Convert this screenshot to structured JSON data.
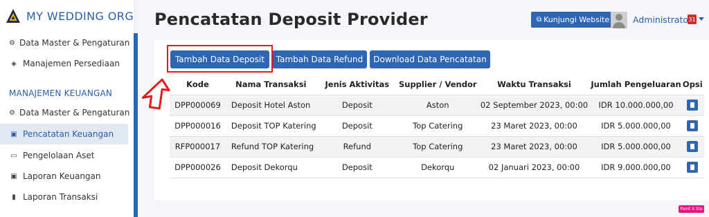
{
  "brand": {
    "title": "MY WEDDING ORGAN"
  },
  "sidebar": {
    "items_top": [
      {
        "label": "Data Master & Pengaturan",
        "icon": "gears-icon"
      },
      {
        "label": "Manajemen Persediaan",
        "icon": "cubes-icon"
      }
    ],
    "section_label": "MANAJEMEN KEUANGAN",
    "items_finance": [
      {
        "label": "Data Master & Pengaturan",
        "icon": "gears-icon"
      },
      {
        "label": "Pencatatan Keuangan",
        "icon": "money-icon",
        "active": true
      },
      {
        "label": "Pengelolaan Aset",
        "icon": "drive-icon"
      },
      {
        "label": "Laporan Keuangan",
        "icon": "money-icon"
      },
      {
        "label": "Laporan Transaksi",
        "icon": "book-icon"
      }
    ]
  },
  "header": {
    "page_title": "Pencatatan Deposit Provider",
    "visit_button": "Kunjungi Website",
    "user_name": "Administrator",
    "notification_count": "31"
  },
  "toolbar": {
    "add_deposit": "Tambah Data Deposit",
    "add_refund": "Tambah Data Refund",
    "download": "Download Data Pencatatan"
  },
  "table": {
    "columns": [
      "Kode",
      "Nama Transaksi",
      "Jenis Aktivitas",
      "Supplier / Vendor",
      "Waktu Transaksi",
      "Jumlah Pengeluaran",
      "Opsi"
    ],
    "rows": [
      [
        "DPP000069",
        "Deposit Hotel Aston",
        "Deposit",
        "Aston",
        "02 September 2023, 00:00",
        "IDR 10.000.000,00"
      ],
      [
        "DPP000016",
        "Deposit TOP Katering",
        "Deposit",
        "Top Catering",
        "23 Maret 2023, 00:00",
        "IDR 5.000.000,00"
      ],
      [
        "RFP000017",
        "Refund TOP Katering",
        "Refund",
        "Top Catering",
        "23 Maret 2023, 00:00",
        "IDR 5.000.000,00"
      ],
      [
        "DPP000026",
        "Deposit Dekorqu",
        "Deposit",
        "Dekorqu",
        "02 Januari 2023, 00:00",
        "IDR 9.000.000,00"
      ]
    ]
  },
  "watermark": "Paint X lite",
  "colors": {
    "primary": "#2f66b3",
    "highlight": "#e01b1b",
    "badge": "#c9302c"
  }
}
